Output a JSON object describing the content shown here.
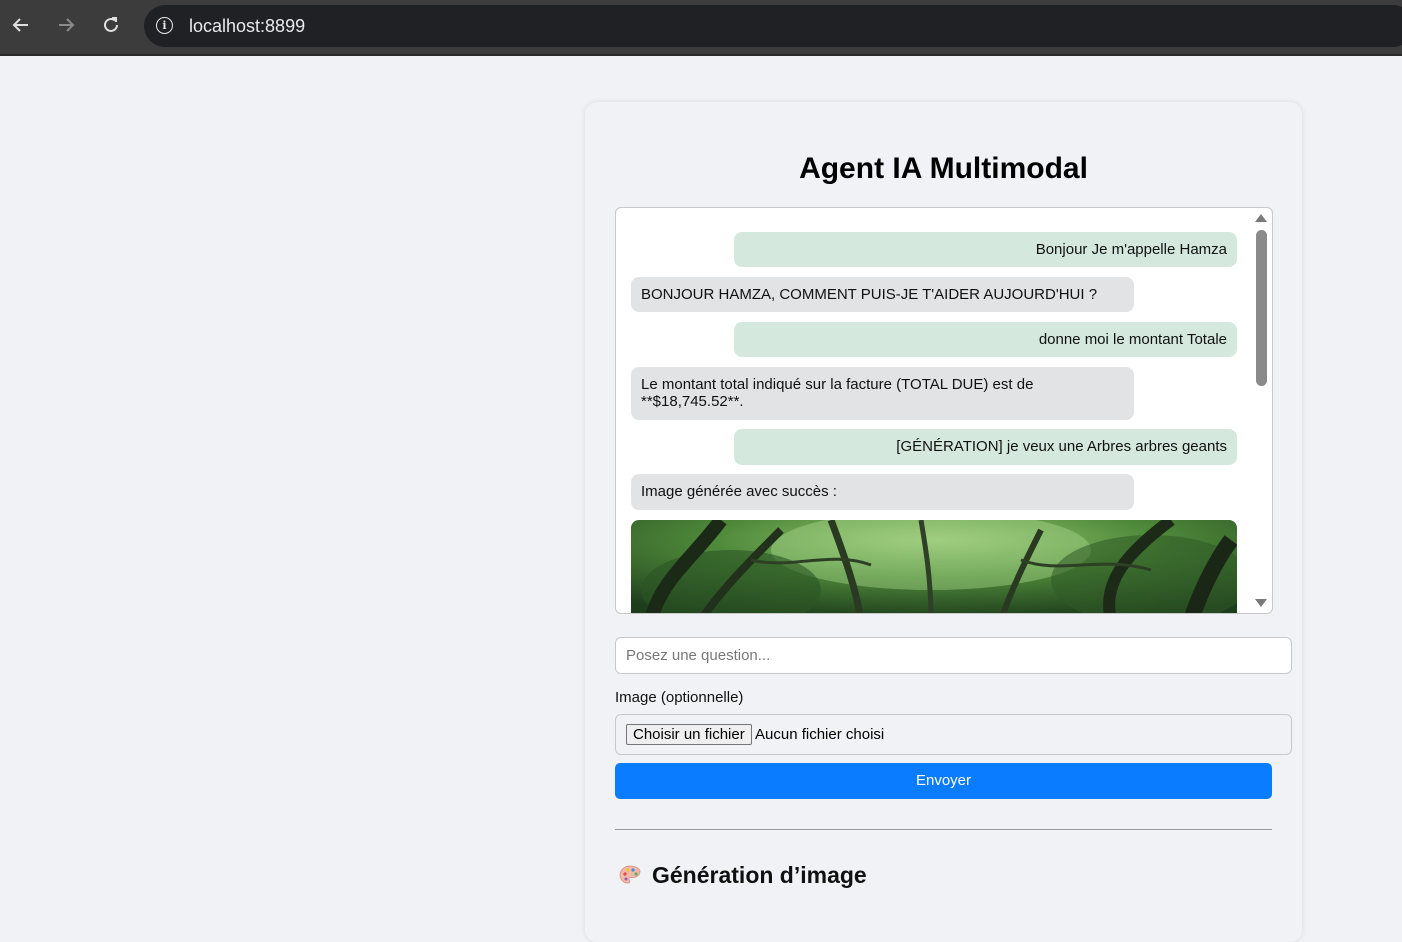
{
  "browser": {
    "url": "localhost:8899"
  },
  "page": {
    "title": "Agent IA Multimodal"
  },
  "chat": {
    "messages": [
      {
        "role": "user",
        "text": "Bonjour Je m'appelle Hamza"
      },
      {
        "role": "bot",
        "text": "BONJOUR HAMZA, COMMENT PUIS-JE T'AIDER AUJOURD'HUI ?"
      },
      {
        "role": "user",
        "text": "donne moi le montant Totale"
      },
      {
        "role": "bot",
        "text": "Le montant total indiqué sur la facture (TOTAL DUE) est de **$18,745.52**."
      },
      {
        "role": "user",
        "text": "[GÉNÉRATION] je veux une Arbres arbres geants"
      },
      {
        "role": "bot",
        "text": "Image générée avec succès :"
      }
    ]
  },
  "form": {
    "question_placeholder": "Posez une question...",
    "image_label": "Image (optionnelle)",
    "file_button": "Choisir un fichier",
    "file_status": "Aucun fichier choisi",
    "send_label": "Envoyer"
  },
  "image_section": {
    "title": "Génération d’image",
    "icon": "palette-icon"
  },
  "colors": {
    "user_bubble": "#d4e8de",
    "bot_bubble": "#e2e3e5",
    "accent": "#0a7cff"
  }
}
